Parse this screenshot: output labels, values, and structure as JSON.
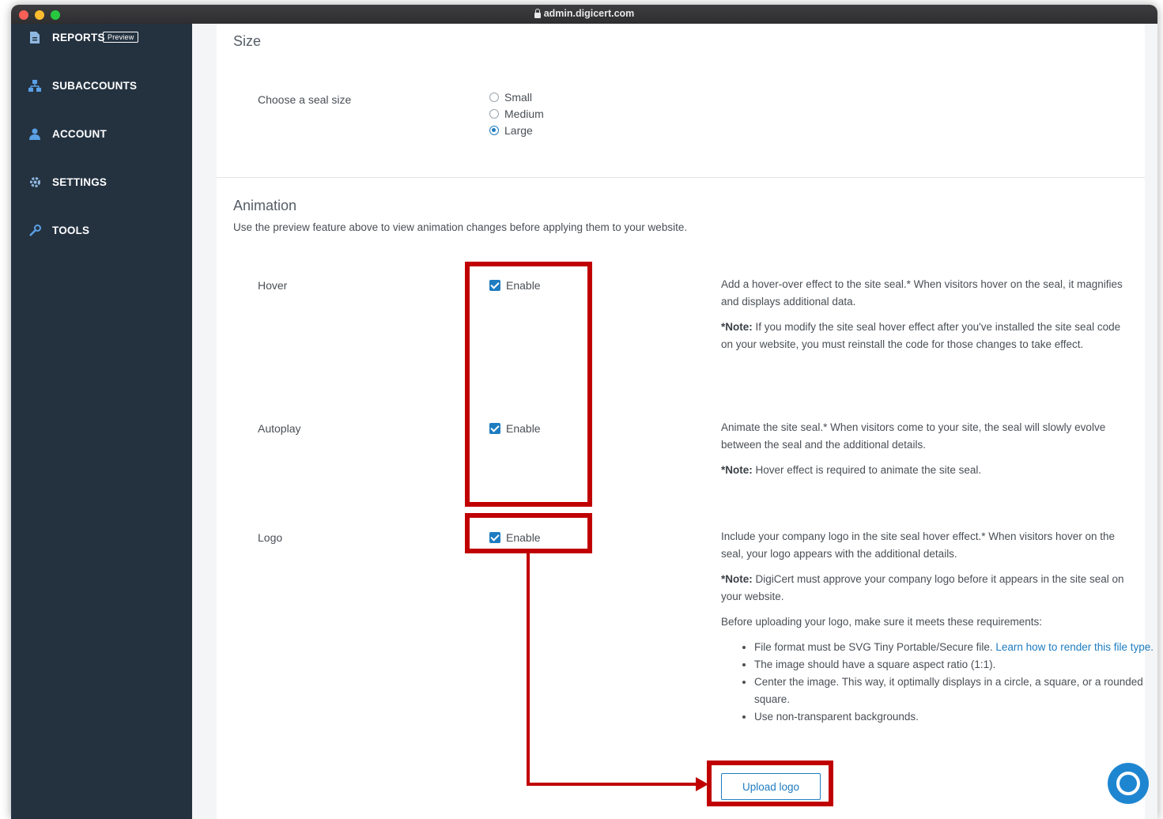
{
  "browser": {
    "url": "admin.digicert.com"
  },
  "sidebar": {
    "items": [
      {
        "label": "REPORTS",
        "icon": "report-icon",
        "badge": "Preview"
      },
      {
        "label": "SUBACCOUNTS",
        "icon": "subaccounts-icon"
      },
      {
        "label": "ACCOUNT",
        "icon": "user-icon"
      },
      {
        "label": "SETTINGS",
        "icon": "gear-icon"
      },
      {
        "label": "TOOLS",
        "icon": "wrench-icon"
      }
    ]
  },
  "size": {
    "title": "Size",
    "label": "Choose a seal size",
    "options": [
      "Small",
      "Medium",
      "Large"
    ],
    "selected": "Large"
  },
  "animation": {
    "title": "Animation",
    "subtitle": "Use the preview feature above to view animation changes before applying them to your website.",
    "hover": {
      "label": "Hover",
      "checkbox": "Enable",
      "desc": "Add a hover-over effect to the site seal.* When visitors hover on the seal, it magnifies and displays additional data.",
      "note_label": "*Note:",
      "note": "If you modify the site seal hover effect after you've installed the site seal code on your website, you must reinstall the code for those changes to take effect."
    },
    "autoplay": {
      "label": "Autoplay",
      "checkbox": "Enable",
      "desc": "Animate the site seal.* When visitors come to your site, the seal will slowly evolve between the seal and the additional details.",
      "note_label": "*Note:",
      "note": "Hover effect is required to animate the site seal."
    },
    "logo": {
      "label": "Logo",
      "checkbox": "Enable",
      "desc": "Include your company logo in the site seal hover effect.* When visitors hover on the seal, your logo appears with the additional details.",
      "note_label": "*Note:",
      "note": "DigiCert must approve your company logo before it appears in the site seal on your website.",
      "requirements_intro": "Before uploading your logo, make sure it meets these requirements:",
      "req1_text": "File format must be SVG Tiny Portable/Secure file.",
      "req1_link": "Learn how to render this file type.",
      "req2": "The image should have a square aspect ratio (1:1).",
      "req3": "Center the image. This way, it optimally displays in a circle, a square, or a rounded square.",
      "req4": "Use non-transparent backgrounds.",
      "upload_button": "Upload logo"
    }
  },
  "colors": {
    "sidebar_bg": "#243240",
    "accent": "#1e7cc1",
    "highlight": "#c00000"
  }
}
